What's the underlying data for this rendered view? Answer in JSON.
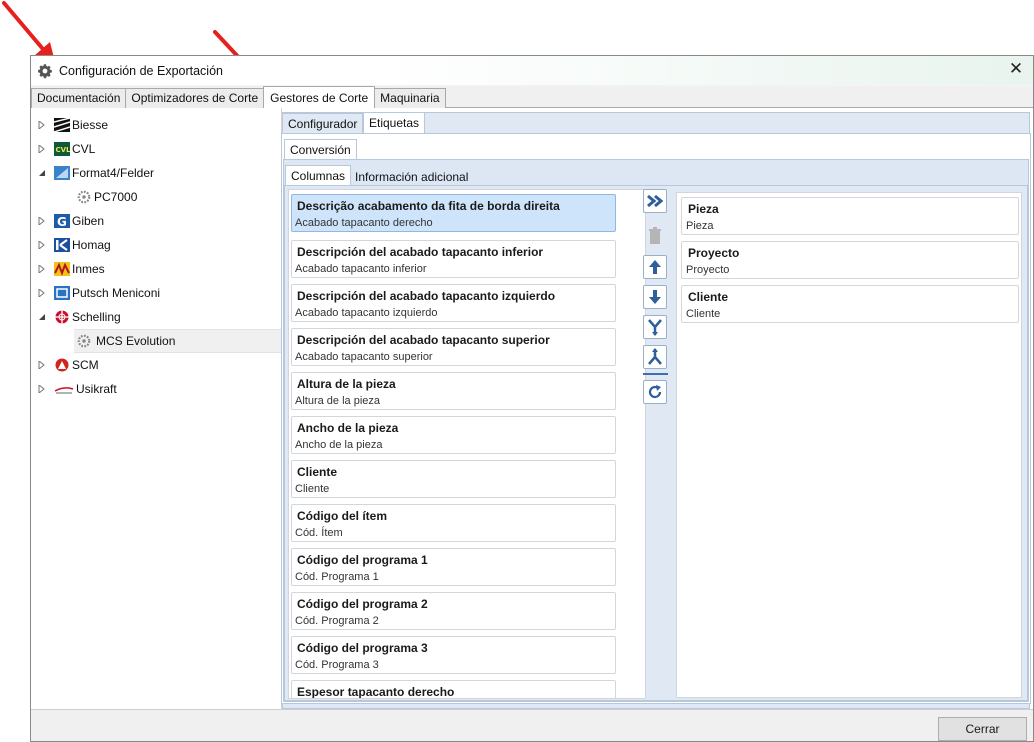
{
  "window": {
    "title": "Configuración de Exportación",
    "close_glyph": "✕"
  },
  "top_tabs": [
    {
      "label": "Documentación"
    },
    {
      "label": "Optimizadores de Corte"
    },
    {
      "label": "Gestores de Corte"
    },
    {
      "label": "Maquinaria"
    }
  ],
  "tree": [
    {
      "label": "Biesse",
      "icon": "biesse-logo-icon"
    },
    {
      "label": "CVL",
      "icon": "cvl-logo-icon"
    },
    {
      "label": "Format4/Felder",
      "icon": "format4-logo-icon"
    },
    {
      "label": "PC7000",
      "icon": "gear-icon"
    },
    {
      "label": "Giben",
      "icon": "giben-logo-icon"
    },
    {
      "label": "Homag",
      "icon": "homag-logo-icon"
    },
    {
      "label": "Inmes",
      "icon": "inmes-logo-icon"
    },
    {
      "label": "Putsch Meniconi",
      "icon": "putsch-logo-icon"
    },
    {
      "label": "Schelling",
      "icon": "schelling-logo-icon"
    },
    {
      "label": "MCS Evolution",
      "icon": "gear-icon"
    },
    {
      "label": "SCM",
      "icon": "scm-logo-icon"
    },
    {
      "label": "Usikraft",
      "icon": "usikraft-logo-icon"
    }
  ],
  "sub_tabs": {
    "configurador": "Configurador",
    "etiquetas": "Etiquetas"
  },
  "conversion_tab": "Conversión",
  "inner_tabs": {
    "columnas": "Columnas",
    "info": "Información adicional"
  },
  "available_columns": [
    {
      "title": "Descrição acabamento da fita de borda direita",
      "subtitle": "Acabado tapacanto derecho"
    },
    {
      "title": "Descripción del acabado tapacanto inferior",
      "subtitle": "Acabado tapacanto inferior"
    },
    {
      "title": "Descripción del acabado tapacanto izquierdo",
      "subtitle": "Acabado tapacanto izquierdo"
    },
    {
      "title": "Descripción del acabado tapacanto superior",
      "subtitle": "Acabado tapacanto superior"
    },
    {
      "title": "Altura de la pieza",
      "subtitle": "Altura de la pieza"
    },
    {
      "title": "Ancho de la pieza",
      "subtitle": "Ancho de la pieza"
    },
    {
      "title": "Cliente",
      "subtitle": "Cliente"
    },
    {
      "title": "Código del ítem",
      "subtitle": "Cód. Ítem"
    },
    {
      "title": "Código del programa 1",
      "subtitle": "Cód. Programa 1"
    },
    {
      "title": "Código del programa 2",
      "subtitle": "Cód. Programa 2"
    },
    {
      "title": "Código del programa 3",
      "subtitle": "Cód. Programa 3"
    },
    {
      "title": "Espesor tapacanto derecho",
      "subtitle": ""
    }
  ],
  "selected_columns": [
    {
      "title": "Pieza",
      "subtitle": "Pieza"
    },
    {
      "title": "Proyecto",
      "subtitle": "Proyecto"
    },
    {
      "title": "Cliente",
      "subtitle": "Cliente"
    }
  ],
  "footer": {
    "close_label": "Cerrar"
  },
  "colors": {
    "accent": "#3d6fae",
    "selection": "#cde4fb",
    "pane": "#dfe8f3",
    "annotation_arrow": "#e5201d"
  }
}
